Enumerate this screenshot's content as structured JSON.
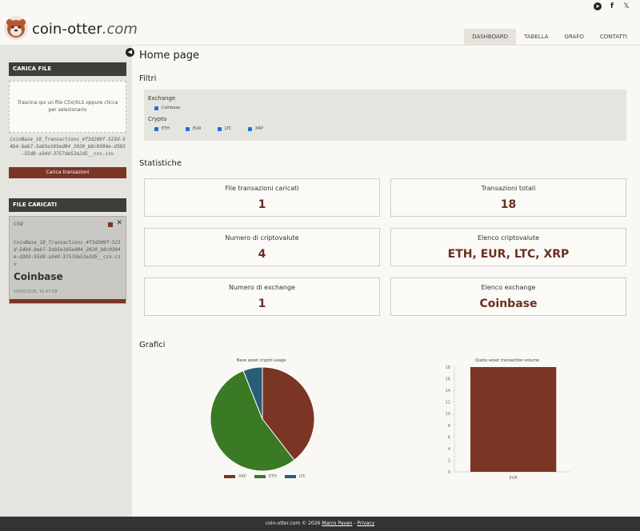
{
  "social": {
    "telegram": "telegram-icon",
    "facebook": "facebook-icon",
    "twitter": "twitter-icon"
  },
  "brand": {
    "name": "coin-otter",
    "tld": ".com"
  },
  "nav": [
    "DASHBOARD",
    "TABELLA",
    "GRAFO",
    "CONTATTI"
  ],
  "sidebar": {
    "upload_title": "CARICA FILE",
    "dropzone_text": "Trascina qui un file CSV/XLS oppure clicca per selezionarlo",
    "filename": "CoinBase_18_Transactions_4f3d209f-523d-54b4-beb7-3ab5e105ed04_2020_b8c0304e-d393-55d8-a34d-3757de52e2d5__csv.csv",
    "upload_button": "Carica transazioni",
    "loaded_title": "FILE CARICATI",
    "file": {
      "type": "CSV",
      "name": "CoinBase_18_Transactions_4f3d209f-523d-54b4-beb7-3ab5e105ed04_2020_b8c0304e-d393-55d8-a34d-3757de52e2d5__csv.csv",
      "exchange": "Coinbase",
      "date": "19/02/2026, 16:47:58"
    }
  },
  "main": {
    "title": "Home page",
    "filters_title": "Filtri",
    "exchange_label": "Exchange",
    "exchange_options": [
      "Coinbase"
    ],
    "crypto_label": "Crypto",
    "crypto_options": [
      "ETH",
      "EUR",
      "LTC",
      "XRP"
    ],
    "stats_title": "Statistiche",
    "stats": [
      {
        "label": "File transazioni caricati",
        "value": "1"
      },
      {
        "label": "Transazioni totali",
        "value": "18"
      },
      {
        "label": "Numero di criptovalute",
        "value": "4"
      },
      {
        "label": "Elenco criptovalute",
        "value": "ETH, EUR, LTC, XRP"
      },
      {
        "label": "Numero di exchange",
        "value": "1"
      },
      {
        "label": "Elenco exchange",
        "value": "Coinbase"
      }
    ],
    "charts_title": "Grafici"
  },
  "chart_data": [
    {
      "type": "pie",
      "title": "Base asset crypto usage",
      "categories": [
        "XRP",
        "ETH",
        "LTC"
      ],
      "values": [
        39.5,
        54.5,
        6
      ],
      "colors": [
        "#7a3525",
        "#3a7a24",
        "#2a5d7a"
      ]
    },
    {
      "type": "bar",
      "title": "Quote asset transaction volume",
      "categories": [
        "EUR"
      ],
      "values": [
        18
      ],
      "ylim": [
        0,
        18
      ],
      "yticks": [
        0,
        2,
        4,
        6,
        8,
        10,
        12,
        14,
        16,
        18
      ],
      "colors": [
        "#7a3525"
      ]
    }
  ],
  "footer": {
    "text": "coin-otter.com © 2026",
    "author": "Marco Pavan",
    "sep": "-",
    "privacy": "Privacy"
  }
}
